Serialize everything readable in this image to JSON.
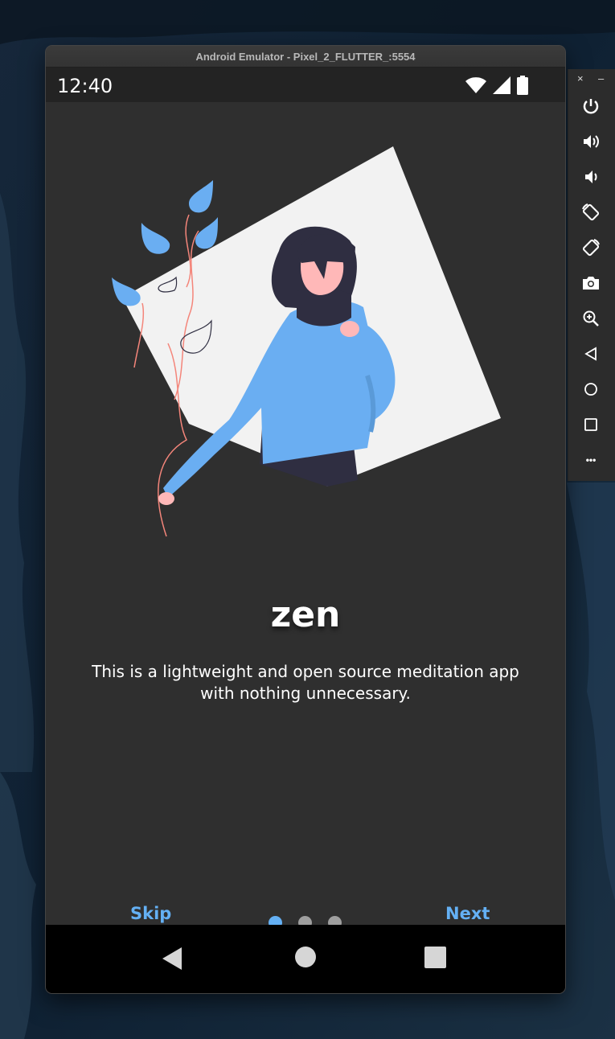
{
  "window": {
    "title": "Android Emulator - Pixel_2_FLUTTER_:5554"
  },
  "status_bar": {
    "time": "12:40",
    "icons": [
      "wifi-icon",
      "signal-icon",
      "battery-icon"
    ]
  },
  "onboarding": {
    "title": "zen",
    "description": "This is a lightweight and open source meditation app with nothing unnecessary.",
    "skip_label": "Skip",
    "next_label": "Next",
    "page_count": 3,
    "current_page": 1
  },
  "nav_bar": {
    "buttons": [
      "back-icon",
      "home-icon",
      "recents-icon"
    ]
  },
  "side_toolbar": {
    "close_label": "×",
    "minimize_label": "–",
    "more_label": "•••",
    "tools": [
      "power-icon",
      "volume-up-icon",
      "volume-down-icon",
      "rotate-left-icon",
      "rotate-right-icon",
      "camera-icon",
      "zoom-icon",
      "back-icon",
      "home-icon",
      "overview-icon",
      "more-icon"
    ]
  },
  "colors": {
    "accent": "#64b0f4",
    "app_background": "#2f2f2f",
    "inactive_dot": "#9e9e9e",
    "sweater": "#6aaef2",
    "dark_figure": "#2f2e41",
    "skin": "#ffb8b8",
    "card": "#f2f2f2"
  }
}
